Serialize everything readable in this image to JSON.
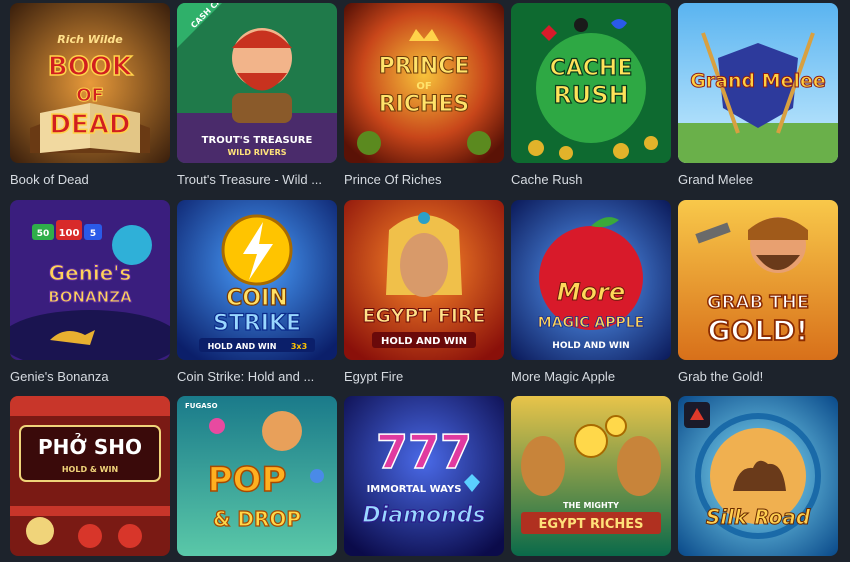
{
  "games": [
    {
      "id": "book-of-dead",
      "name": "Book of Dead",
      "art": [
        "Rich Wilde",
        "BOOK",
        "OF",
        "DEAD"
      ],
      "colors": {
        "bg1": "#3a1f0c",
        "bg2": "#b86b1f",
        "accent": "#d11f1f",
        "text": "#ffd24a"
      },
      "icon": "open-book-icon"
    },
    {
      "id": "trouts-treasure",
      "name": "Trout's Treasure - Wild ...",
      "art": [
        "CASH CATCHER",
        "TROUT'S TREASURE",
        "WILD RIVERS"
      ],
      "colors": {
        "bg1": "#0f5a3a",
        "bg2": "#4a2b6b",
        "accent": "#e23b2e",
        "text": "#ffffff"
      },
      "icon": "fisherman-icon"
    },
    {
      "id": "prince-of-riches",
      "name": "Prince Of Riches",
      "art": [
        "PRINCE",
        "OF",
        "RICHES"
      ],
      "colors": {
        "bg1": "#7a1a0a",
        "bg2": "#f0a526",
        "accent": "#5b8a1f",
        "text": "#ffe36b"
      },
      "icon": "crown-icon"
    },
    {
      "id": "cache-rush",
      "name": "Cache Rush",
      "art": [
        "CACHE",
        "RUSH"
      ],
      "colors": {
        "bg1": "#0b5a2a",
        "bg2": "#35b24a",
        "accent": "#e2b32a",
        "text": "#ffe35a"
      },
      "icon": "card-suits-icon"
    },
    {
      "id": "grand-melee",
      "name": "Grand Melee",
      "art": [
        "Grand Melee"
      ],
      "colors": {
        "bg1": "#4aa8e8",
        "bg2": "#8fd1ff",
        "accent": "#2d3a9c",
        "text": "#ffd040"
      },
      "icon": "shield-icon"
    },
    {
      "id": "genies-bonanza",
      "name": "Genie's Bonanza",
      "art": [
        "Genie's",
        "BONANZA",
        "50",
        "100",
        "5"
      ],
      "colors": {
        "bg1": "#1a1450",
        "bg2": "#5a2b9e",
        "accent": "#2fb0d8",
        "text": "#ffd35a"
      },
      "icon": "genie-lamp-icon"
    },
    {
      "id": "coin-strike",
      "name": "Coin Strike: Hold and ...",
      "art": [
        "COIN",
        "STRIKE",
        "HOLD AND WIN",
        "3x3"
      ],
      "colors": {
        "bg1": "#0b2a8a",
        "bg2": "#2e6ce8",
        "accent": "#ffc400",
        "text": "#ffe066"
      },
      "icon": "lightning-coin-icon"
    },
    {
      "id": "egypt-fire",
      "name": "Egypt Fire",
      "art": [
        "EGYPT FIRE",
        "HOLD AND WIN"
      ],
      "colors": {
        "bg1": "#b3201a",
        "bg2": "#ff7a1a",
        "accent": "#f0c04a",
        "text": "#ffe28a"
      },
      "icon": "pharaoh-queen-icon"
    },
    {
      "id": "more-magic-apple",
      "name": "More Magic Apple",
      "art": [
        "More",
        "MAGIC APPLE",
        "HOLD AND WIN"
      ],
      "colors": {
        "bg1": "#1a3a8a",
        "bg2": "#3a7ae8",
        "accent": "#d81a2a",
        "text": "#ffd85a"
      },
      "icon": "apple-icon"
    },
    {
      "id": "grab-the-gold",
      "name": "Grab the Gold!",
      "art": [
        "GRAB THE",
        "GOLD!"
      ],
      "colors": {
        "bg1": "#e3871a",
        "bg2": "#f8c84a",
        "accent": "#5a8a3a",
        "text": "#ffffff"
      },
      "icon": "miner-icon"
    },
    {
      "id": "pho-sho",
      "name": "",
      "art": [
        "PHỞ SHO",
        "HOLD & WIN"
      ],
      "colors": {
        "bg1": "#5a0f12",
        "bg2": "#c8362a",
        "accent": "#f0d47a",
        "text": "#ffffff"
      },
      "icon": "noodle-bowl-icon"
    },
    {
      "id": "pop-drop",
      "name": "",
      "art": [
        "FUGASO",
        "POP",
        "& DROP"
      ],
      "colors": {
        "bg1": "#1a8a8a",
        "bg2": "#3ab0c8",
        "accent": "#ffb020",
        "text": "#ffd84a"
      },
      "icon": "cat-icon"
    },
    {
      "id": "immortal-ways-diamonds",
      "name": "",
      "art": [
        "777",
        "IMMORTAL WAYS",
        "Diamonds"
      ],
      "colors": {
        "bg1": "#1a1a6a",
        "bg2": "#3a3ab0",
        "accent": "#e03aa0",
        "text": "#ffffff"
      },
      "icon": "diamond-icon"
    },
    {
      "id": "mighty-egypt-riches",
      "name": "",
      "art": [
        "THE MIGHTY",
        "EGYPT RICHES"
      ],
      "colors": {
        "bg1": "#0a6a4a",
        "bg2": "#e8c44a",
        "accent": "#b03020",
        "text": "#ffe07a"
      },
      "icon": "coin-icon"
    },
    {
      "id": "silk-road",
      "name": "",
      "art": [
        "Silk Road"
      ],
      "colors": {
        "bg1": "#0a5a9a",
        "bg2": "#3ad0ff",
        "accent": "#d89030",
        "text": "#ffd050"
      },
      "icon": "camel-icon"
    }
  ]
}
